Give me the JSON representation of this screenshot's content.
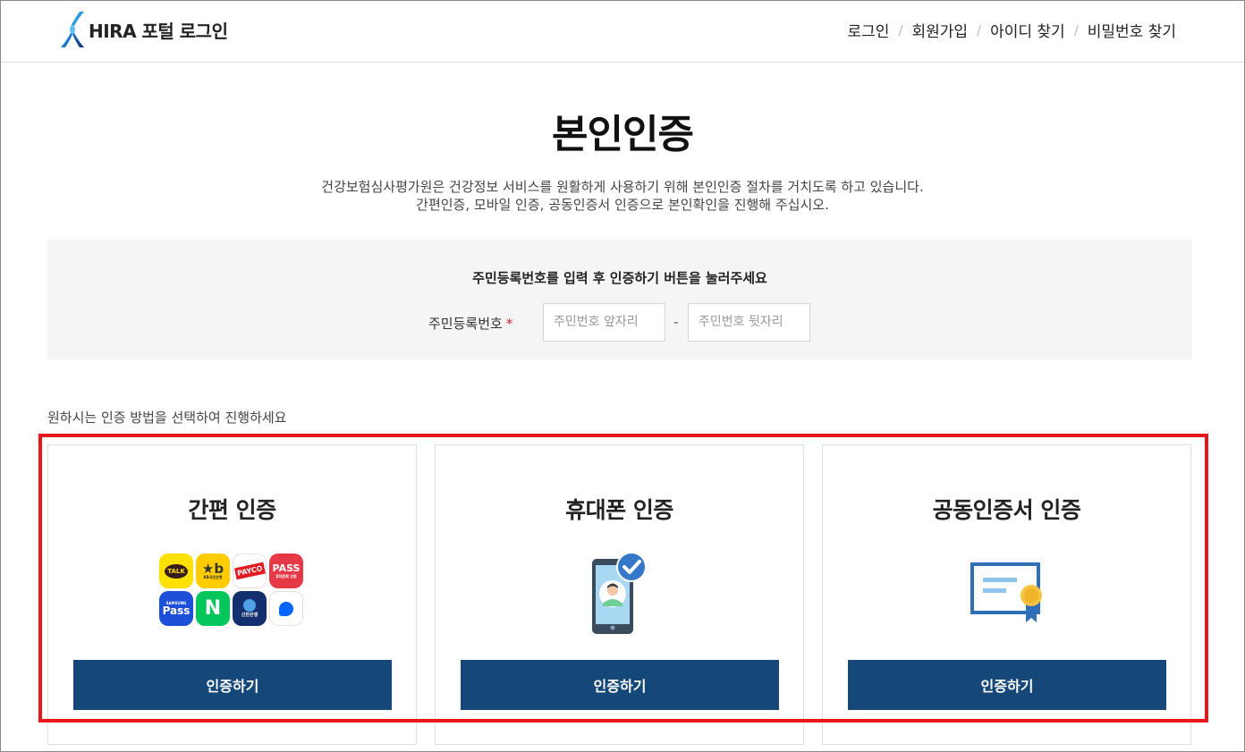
{
  "header": {
    "logo_text": "HIRA 포털 로그인",
    "nav": [
      "로그인",
      "회원가입",
      "아이디 찾기",
      "비밀번호 찾기"
    ]
  },
  "main": {
    "title": "본인인증",
    "desc_line1": "건강보험심사평가원은 건강정보 서비스를 원활하게 사용하기 위해 본인인증 절차를 거치도록 하고 있습니다.",
    "desc_line2": "간편인증, 모바일 인증, 공동인증서 인증으로 본인확인을 진행해 주십시오."
  },
  "rrn": {
    "guide": "주민등록번호를 입력 후 인증하기 버튼을 눌러주세요",
    "label": "주민등록번호",
    "required_mark": "*",
    "front_placeholder": "주민번호 앞자리",
    "back_placeholder": "주민번호 뒷자리",
    "dash": "-"
  },
  "methods": {
    "prompt": "원하시는 인증 방법을 선택하여 진행하세요",
    "cards": [
      {
        "title": "간편 인증",
        "button": "인증하기",
        "icon": "simple-auth-apps-icon"
      },
      {
        "title": "휴대폰 인증",
        "button": "인증하기",
        "icon": "mobile-phone-check-icon"
      },
      {
        "title": "공동인증서 인증",
        "button": "인증하기",
        "icon": "certificate-icon"
      }
    ]
  },
  "apps": [
    {
      "name": "kakao-talk",
      "label": "TALK",
      "bg": "#ffe100",
      "fg": "#3a1d1d"
    },
    {
      "name": "kb-bank",
      "label": "KB국민은행",
      "bg": "#ffcc00",
      "fg": "#333333"
    },
    {
      "name": "payco",
      "label": "PAYCO",
      "bg": "#ffffff",
      "fg": "#e21b23"
    },
    {
      "name": "pass",
      "label": "PASS",
      "bg": "#e63946",
      "fg": "#ffffff",
      "sub": "휴대전화 인증"
    },
    {
      "name": "samsung-pass",
      "label": "Pass",
      "bg": "#1e4fd8",
      "fg": "#ffffff",
      "sub": "SAMSUNG"
    },
    {
      "name": "naver",
      "label": "N",
      "bg": "#03c75a",
      "fg": "#ffffff"
    },
    {
      "name": "shinhan-bank",
      "label": "신한은행",
      "bg": "#142f6e",
      "fg": "#ffffff"
    },
    {
      "name": "toss",
      "label": "",
      "bg": "#ffffff",
      "fg": "#0064ff"
    }
  ],
  "colors": {
    "primary_button": "#154878",
    "highlight_border": "#e8161b",
    "required": "#d9232d"
  }
}
